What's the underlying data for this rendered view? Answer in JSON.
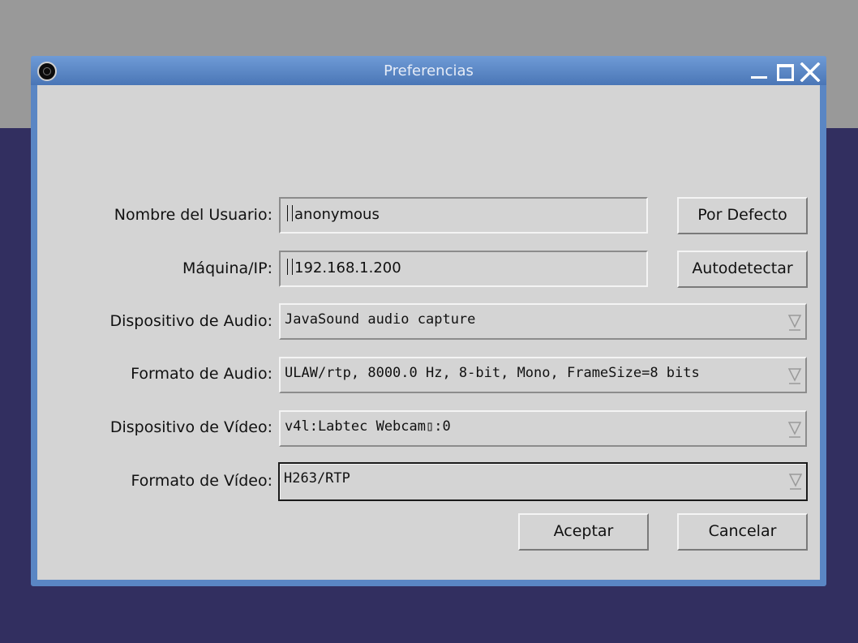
{
  "window": {
    "title": "Preferencias"
  },
  "form": {
    "username_label": "Nombre del Usuario:",
    "username_value": "anonymous",
    "host_label": "Máquina/IP:",
    "host_value": "192.168.1.200",
    "audio_device_label": "Dispositivo de Audio:",
    "audio_device_value": "JavaSound audio capture",
    "audio_format_label": "Formato de Audio:",
    "audio_format_value": "ULAW/rtp, 8000.0 Hz, 8-bit, Mono, FrameSize=8 bits",
    "video_device_label": "Dispositivo de Vídeo:",
    "video_device_value": "v4l:Labtec Webcam▯:0",
    "video_format_label": "Formato de Vídeo:",
    "video_format_value": "H263/RTP"
  },
  "buttons": {
    "default": "Por Defecto",
    "autodetect": "Autodetectar",
    "accept": "Aceptar",
    "cancel": "Cancelar"
  },
  "icons": {
    "app": "app-icon",
    "minimize": "minimize-icon",
    "maximize": "maximize-icon",
    "close": "close-icon",
    "dropdown": "dropdown-arrow-icon"
  },
  "colors": {
    "desktop": "#322f60",
    "desktop_band": "#999999",
    "titlebar": "#5a86c4",
    "dialog_bg": "#d4d4d4"
  }
}
